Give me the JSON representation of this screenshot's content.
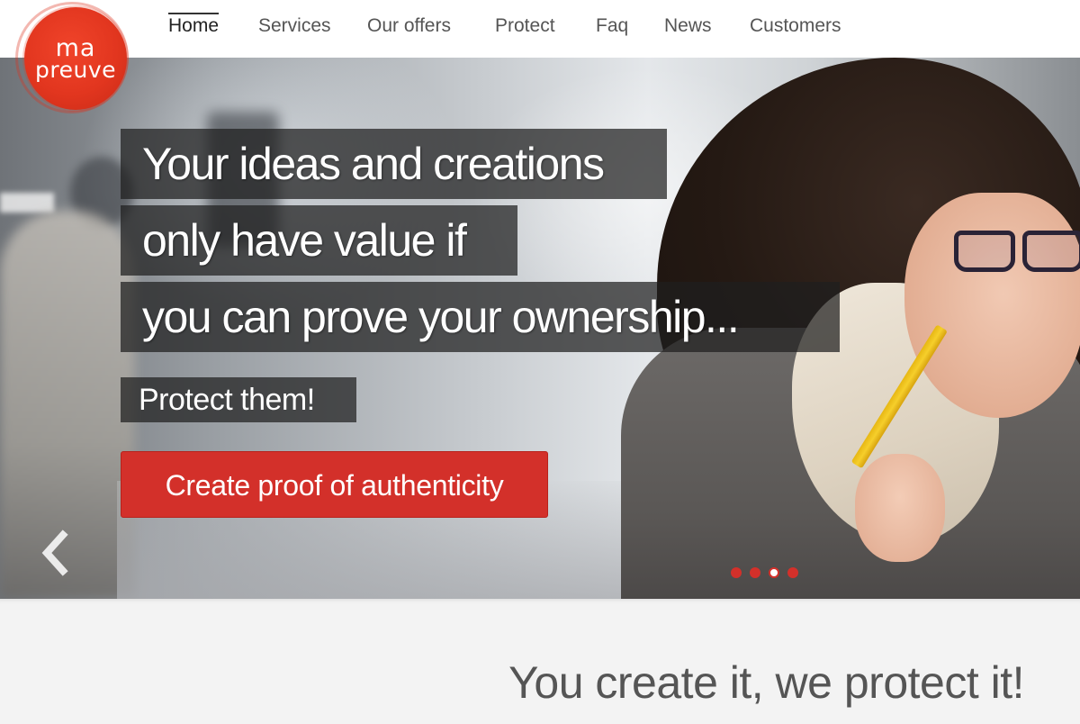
{
  "logo": {
    "line1": "ma",
    "line2": "preuve",
    "color": "#e2361f"
  },
  "nav": {
    "items": [
      {
        "label": "Home",
        "active": true
      },
      {
        "label": "Services",
        "active": false
      },
      {
        "label": "Our offers",
        "active": false
      },
      {
        "label": "Protect",
        "active": false
      },
      {
        "label": "Faq",
        "active": false
      },
      {
        "label": "News",
        "active": false
      },
      {
        "label": "Customers",
        "active": false
      }
    ]
  },
  "hero": {
    "headline": [
      "Your ideas and creations",
      "only have value if",
      "you can prove your ownership..."
    ],
    "subheadline": "Protect them!",
    "cta_label": "Create proof of authenticity",
    "cta_color": "#d3302a",
    "prev_icon": "chevron-left-icon",
    "slides": {
      "count": 4,
      "active_index": 2
    }
  },
  "section": {
    "tagline": "You create it, we protect it!"
  }
}
